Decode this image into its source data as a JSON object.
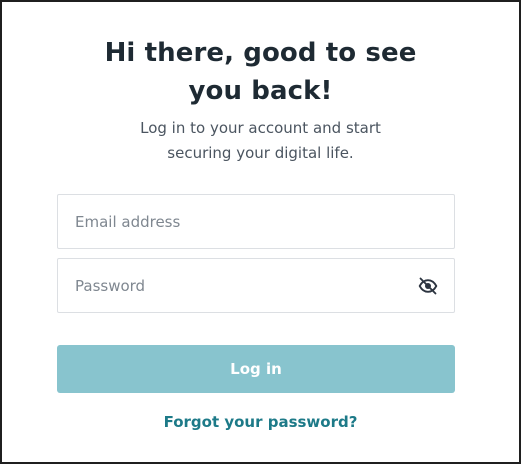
{
  "heading": {
    "line1": "Hi there, good to see",
    "line2": "you back!"
  },
  "subheading": {
    "line1": "Log in to your account and start",
    "line2": "securing your digital life."
  },
  "form": {
    "email_placeholder": "Email address",
    "email_value": "",
    "password_placeholder": "Password",
    "password_value": "",
    "password_toggle_icon": "eye-off-icon",
    "login_label": "Log in",
    "forgot_label": "Forgot your password?"
  },
  "colors": {
    "heading": "#1e2a33",
    "subheading": "#4b5560",
    "login_button_bg": "#88c4ce",
    "link": "#1d7a88",
    "field_border": "#dcdfe3"
  }
}
